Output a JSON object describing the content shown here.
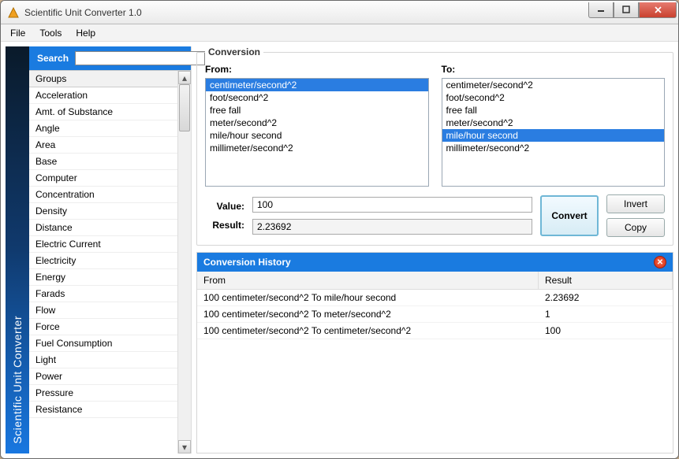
{
  "window": {
    "title": "Scientific Unit Converter 1.0"
  },
  "menu": {
    "file": "File",
    "tools": "Tools",
    "help": "Help"
  },
  "vstrip": "Scientific Unit Converter",
  "search": {
    "label": "Search",
    "value": ""
  },
  "groups": {
    "header": "Groups",
    "items": [
      "Acceleration",
      "Amt. of Substance",
      "Angle",
      "Area",
      "Base",
      "Computer",
      "Concentration",
      "Density",
      "Distance",
      "Electric Current",
      "Electricity",
      "Energy",
      "Farads",
      "Flow",
      "Force",
      "Fuel Consumption",
      "Light",
      "Power",
      "Pressure",
      "Resistance"
    ]
  },
  "conversion": {
    "legend": "Conversion",
    "from_label": "From:",
    "to_label": "To:",
    "units": [
      "centimeter/second^2",
      "foot/second^2",
      "free fall",
      "meter/second^2",
      "mile/hour second",
      "millimeter/second^2"
    ],
    "from_selected": 0,
    "to_selected": 4,
    "value_label": "Value:",
    "result_label": "Result:",
    "value": "100",
    "result": "2.23692",
    "convert_btn": "Convert",
    "invert_btn": "Invert",
    "copy_btn": "Copy"
  },
  "history": {
    "title": "Conversion History",
    "col_from": "From",
    "col_result": "Result",
    "rows": [
      {
        "from": "100 centimeter/second^2 To mile/hour second",
        "result": "2.23692"
      },
      {
        "from": "100 centimeter/second^2 To meter/second^2",
        "result": "1"
      },
      {
        "from": "100 centimeter/second^2 To centimeter/second^2",
        "result": "100"
      }
    ]
  }
}
